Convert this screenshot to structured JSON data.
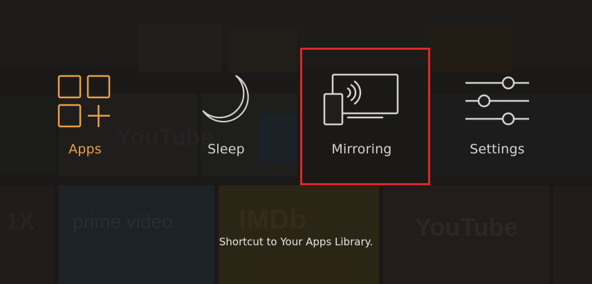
{
  "menu": {
    "items": [
      {
        "label": "Apps",
        "icon": "apps-grid-icon",
        "selected": true
      },
      {
        "label": "Sleep",
        "icon": "moon-icon",
        "selected": false
      },
      {
        "label": "Mirroring",
        "icon": "mirroring-icon",
        "selected": false
      },
      {
        "label": "Settings",
        "icon": "sliders-icon",
        "selected": false
      }
    ],
    "caption": "Shortcut to Your Apps Library."
  },
  "colors": {
    "accent": "#e9a04a",
    "label": "#d4d3d1",
    "highlight_box": "#e0262a",
    "background": "#1f1e1d"
  }
}
